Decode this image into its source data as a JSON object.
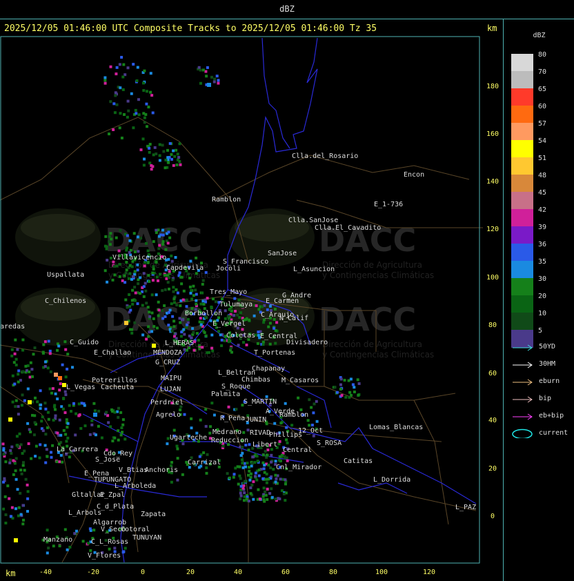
{
  "window_title": "dBZ",
  "header_text": "2025/12/05 01:46:00 UTC Composite Tracks to 2025/12/05 01:46:00 Tz 35",
  "km_unit_top": "km",
  "km_unit_bottom": "km",
  "y_axis_ticks": [
    "180",
    "160",
    "140",
    "120",
    "100",
    "80",
    "60",
    "40",
    "20",
    "0"
  ],
  "x_axis_ticks": [
    "-40",
    "-20",
    "0",
    "20",
    "40",
    "60",
    "80",
    "100",
    "120"
  ],
  "watermark": {
    "brand": "DACC",
    "line1": "Dirección de Agricultura",
    "line2": "y Contingencias Climáticas"
  },
  "place_labels": [
    "Clla.del_Rosario",
    "Encon",
    "Ramblon",
    "E_1-736",
    "Clla.SanJose",
    "Clla.El_Cavadito",
    "Villavicencio",
    "S_Francisco",
    "SanJose",
    "L_Asuncion",
    "Uspallata",
    "Capdevila",
    "Jocoli",
    "Tres_Mayo",
    "G_Andre",
    "E_Carmen",
    "C_Chilenos",
    "Tulumaya",
    "C_Araujo",
    "N_Calif",
    "aredas",
    "Borbollon",
    "E_Vergel",
    "Coletas",
    "E_Central",
    "Divisadero",
    "C_Guido",
    "L_HERAS",
    "E_Challao",
    "MENDOZA",
    "T_Portenas",
    "G_CRUZ",
    "Chapanay",
    "L_Beltran",
    "MAIPU",
    "Chimbas",
    "M_Casaros",
    "Potrerillos",
    "L_Vegas",
    "Cacheuta",
    "LUJAN",
    "S_Roque",
    "Palmita",
    "Perdriel",
    "S_MARTIN",
    "A_Verde",
    "Ramblon",
    "Agrelo",
    "R_Peña",
    "JUNIN",
    "Lomas_Blancas",
    "12_Oct",
    "RIVAD",
    "Ugarteche",
    "Reduccion",
    "Phillips",
    "Libert",
    "Medrano",
    "S_ROSA",
    "La_Carrera",
    "Cdo_Rey",
    "Central",
    "Catitas",
    "S_Jose",
    "Cnl_Mirador",
    "Carrizal",
    "E_Pena",
    "V_Btias",
    "Anchoris",
    "TUPUNGATO",
    "L_Dorrida",
    "L_Arboleda",
    "L_PAZ",
    "Gltallar",
    "E_Zpal",
    "C_d_Plata",
    "L_Arbols",
    "Zapata",
    "Algarrob",
    "V_Seco",
    "Cotoral",
    "TUNUYAN",
    "Manzano",
    "C_L_Rosas",
    "V_Flores"
  ],
  "legend": {
    "title": "dBZ",
    "scale": [
      {
        "label": "80",
        "color": "#d8d8d8"
      },
      {
        "label": "70",
        "color": "#bcbcbc"
      },
      {
        "label": "65",
        "color": "#ff3a2a"
      },
      {
        "label": "60",
        "color": "#ff6a10"
      },
      {
        "label": "57",
        "color": "#ff9a60"
      },
      {
        "label": "54",
        "color": "#ffff00"
      },
      {
        "label": "51",
        "color": "#ffc830"
      },
      {
        "label": "48",
        "color": "#d8883a"
      },
      {
        "label": "45",
        "color": "#c87088"
      },
      {
        "label": "42",
        "color": "#d0209a"
      },
      {
        "label": "39",
        "color": "#7a1ac8"
      },
      {
        "label": "36",
        "color": "#2a5ae8"
      },
      {
        "label": "35",
        "color": "#1a8ae0"
      },
      {
        "label": "30",
        "color": "#15801a"
      },
      {
        "label": "20",
        "color": "#0a6414"
      },
      {
        "label": "10",
        "color": "#104a18"
      },
      {
        "label": "5",
        "color": "#4a3a8a"
      }
    ],
    "tracks": [
      {
        "label": "50YD",
        "color": "#40e0e0"
      },
      {
        "label": "30HM",
        "color": "#ffffff"
      },
      {
        "label": "eburn",
        "color": "#f0c080"
      },
      {
        "label": "bip",
        "color": "#f0c0c0"
      },
      {
        "label": "eb+bip",
        "color": "#ff40ff"
      },
      {
        "label": "current",
        "color": "#20e8e8"
      }
    ]
  }
}
